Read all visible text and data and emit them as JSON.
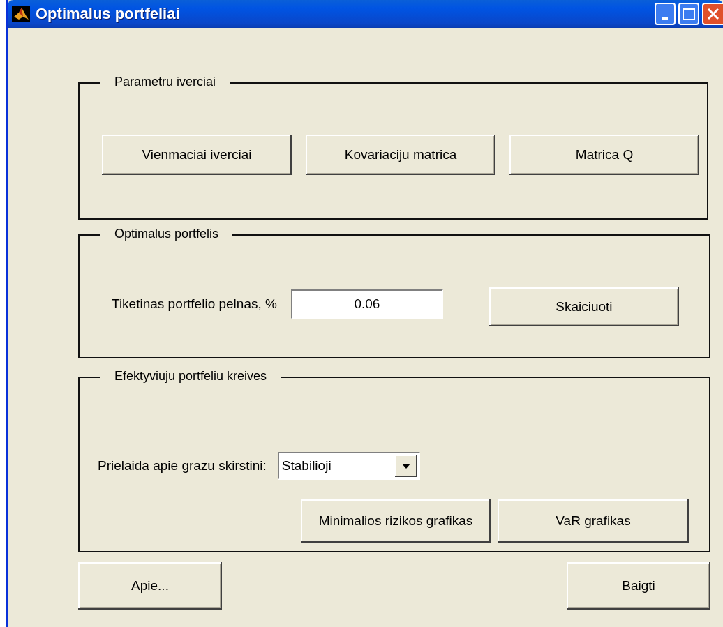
{
  "window": {
    "title": "Optimalus portfeliai"
  },
  "estimates": {
    "title": "Parametru iverciai",
    "buttons": [
      "Vienmaciai iverciai",
      "Kovariaciju matrica",
      "Matrica Q"
    ]
  },
  "optimal": {
    "title": "Optimalus portfelis",
    "label": "Tiketinas portfelio pelnas, %",
    "value": "0.06",
    "button": "Skaiciuoti"
  },
  "curves": {
    "title": "Efektyviuju portfeliu kreives",
    "label": "Prielaida apie grazu skirstini:",
    "dropdown": "Stabilioji",
    "buttons": [
      "Minimalios rizikos grafikas",
      "VaR grafikas"
    ]
  },
  "footer": {
    "buttons": [
      "Apie...",
      "Baigti"
    ]
  }
}
